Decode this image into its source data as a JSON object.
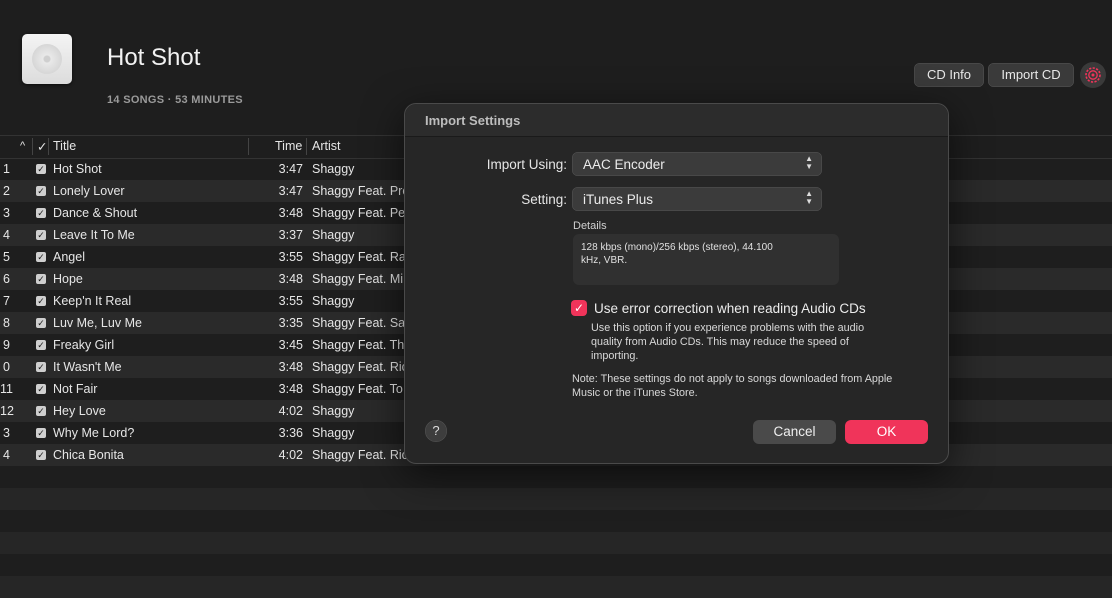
{
  "album": {
    "title": "Hot Shot",
    "meta": "14 SONGS · 53 MINUTES",
    "cd_info_label": "CD Info",
    "import_cd_label": "Import CD",
    "accent": "#f0345a"
  },
  "table": {
    "headers": {
      "sort": "^",
      "check": "✓",
      "title": "Title",
      "time": "Time",
      "artist": "Artist"
    },
    "rows": [
      {
        "num": "1",
        "title": "Hot Shot",
        "time": "3:47",
        "artist": "Shaggy"
      },
      {
        "num": "2",
        "title": "Lonely Lover",
        "time": "3:47",
        "artist": "Shaggy Feat. Pre"
      },
      {
        "num": "3",
        "title": "Dance & Shout",
        "time": "3:48",
        "artist": "Shaggy Feat. Pe"
      },
      {
        "num": "4",
        "title": "Leave It To Me",
        "time": "3:37",
        "artist": "Shaggy"
      },
      {
        "num": "5",
        "title": "Angel",
        "time": "3:55",
        "artist": "Shaggy Feat. Ra"
      },
      {
        "num": "6",
        "title": "Hope",
        "time": "3:48",
        "artist": "Shaggy Feat. Mi"
      },
      {
        "num": "7",
        "title": "Keep'n It Real",
        "time": "3:55",
        "artist": "Shaggy"
      },
      {
        "num": "8",
        "title": "Luv Me, Luv Me",
        "time": "3:35",
        "artist": "Shaggy Feat. Sa"
      },
      {
        "num": "9",
        "title": "Freaky Girl",
        "time": "3:45",
        "artist": "Shaggy Feat. Th"
      },
      {
        "num": "0",
        "title": "It Wasn't Me",
        "time": "3:48",
        "artist": "Shaggy Feat. Ric"
      },
      {
        "num": "11",
        "title": "Not Fair",
        "time": "3:48",
        "artist": "Shaggy Feat. To"
      },
      {
        "num": "12",
        "title": "Hey Love",
        "time": "4:02",
        "artist": "Shaggy"
      },
      {
        "num": "3",
        "title": "Why Me Lord?",
        "time": "3:36",
        "artist": "Shaggy"
      },
      {
        "num": "4",
        "title": "Chica Bonita",
        "time": "4:02",
        "artist": "Shaggy Feat. Ric"
      }
    ]
  },
  "dialog": {
    "title": "Import Settings",
    "import_using_label": "Import Using:",
    "import_using_value": "AAC Encoder",
    "setting_label": "Setting:",
    "setting_value": "iTunes Plus",
    "details_label": "Details",
    "details_text_line1": "128 kbps (mono)/256 kbps (stereo), 44.100",
    "details_text_line2": "kHz, VBR.",
    "error_correction_checked": true,
    "error_correction_label": "Use error correction when reading Audio CDs",
    "error_correction_help": "Use this option if you experience problems with the audio quality from Audio CDs. This may reduce the speed of importing.",
    "note": "Note: These settings do not apply to songs downloaded from Apple Music or the iTunes Store.",
    "help_label": "?",
    "cancel_label": "Cancel",
    "ok_label": "OK"
  }
}
